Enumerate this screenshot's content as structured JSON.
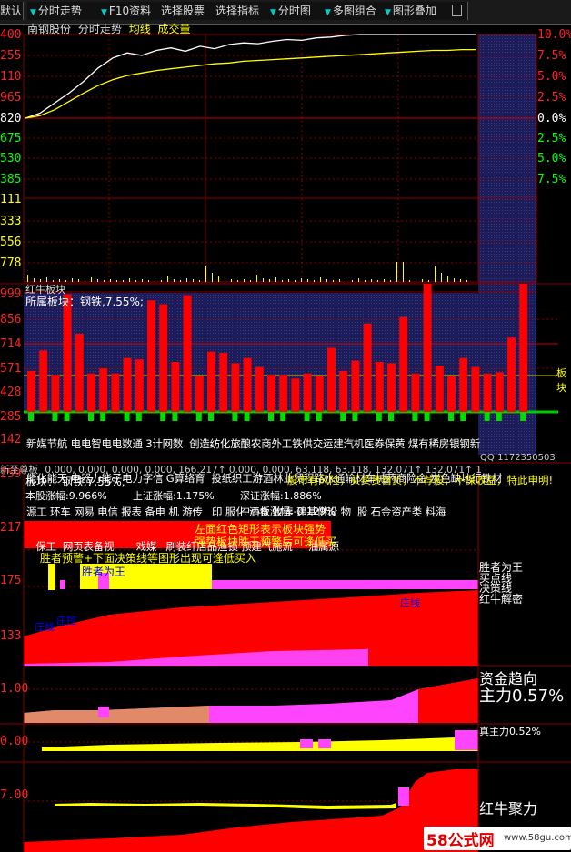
{
  "toolbar": {
    "items": [
      {
        "label": "默认",
        "arrow": true
      },
      {
        "label": "分时走势",
        "arrow": true
      },
      {
        "label": "F10资料",
        "arrow": false
      },
      {
        "label": "选择股票",
        "arrow": false
      },
      {
        "label": "选择指标",
        "arrow": false
      },
      {
        "label": "分时图",
        "arrow": true
      },
      {
        "label": "多图组合",
        "arrow": true
      },
      {
        "label": "图形叠加",
        "arrow": true
      }
    ]
  },
  "intraday": {
    "stock": "南钢股份",
    "view": "分时走势",
    "avg_label": "均线",
    "vol_label": "成交量",
    "left_ticks": [
      "400",
      "255",
      "110",
      "965",
      "820"
    ],
    "right_ticks": [
      "10.0%",
      "7.5%",
      "5.0%",
      "2.5%",
      "0.0%"
    ],
    "left_ticks_low": [
      "675",
      "530",
      "385"
    ],
    "right_ticks_low": [
      "2.5%",
      "5.0%",
      "7.5%"
    ],
    "vol_ticks": [
      "111",
      "333",
      "556",
      "778"
    ]
  },
  "chart_data": [
    {
      "type": "line",
      "title": "分时走势",
      "series": [
        {
          "name": "价格",
          "color": "#ffffff",
          "values": [
            0,
            0.6,
            1.8,
            3.0,
            4.4,
            6.0,
            7.2,
            7.8,
            7.5,
            8.1,
            8.4,
            8.0,
            8.6,
            8.3,
            8.8,
            9.0,
            8.9,
            9.2,
            9.4,
            9.3,
            9.6,
            9.7,
            9.9,
            10.0,
            10.0,
            10.0,
            10.0,
            10.0,
            10.0,
            10.0,
            10.0,
            10.0
          ]
        },
        {
          "name": "均线",
          "color": "#ffff00",
          "values": [
            0,
            0.3,
            1.0,
            2.0,
            3.0,
            3.9,
            4.6,
            5.1,
            5.4,
            5.7,
            5.9,
            6.1,
            6.3,
            6.5,
            6.6,
            6.8,
            6.9,
            7.0,
            7.1,
            7.2,
            7.3,
            7.4,
            7.5,
            7.6,
            7.7,
            7.8,
            7.9,
            8.0,
            8.1,
            8.1,
            8.2,
            8.2
          ]
        }
      ],
      "ylim": [
        0,
        10
      ]
    },
    {
      "type": "bar",
      "title": "红牛板块",
      "subtitle": "所属板块：钢铁,7.55%;",
      "y_ticks": [
        "999",
        "856",
        "714",
        "571",
        "428",
        "285",
        "142"
      ],
      "right_label": "板块",
      "categories": [
        "新媒体",
        "节能",
        "航天",
        "电器",
        "电信",
        "智能",
        "电子",
        "电力",
        "电商",
        "数字",
        "通信",
        "3计",
        "网络",
        "数据",
        "创造",
        "纺织",
        "化工",
        "旅游",
        "酿酒",
        "农业",
        "商贸",
        "外贸",
        "工程",
        "铁路",
        "供水",
        "交通",
        "运输",
        "建材",
        "汽车",
        "机械",
        "医药",
        "券商",
        "保险",
        "黄金",
        "煤炭",
        "有色",
        "稀土",
        "房地产",
        "银行",
        "钢铁",
        "新疆",
        "上海"
      ],
      "values": [
        320,
        480,
        290,
        920,
        610,
        300,
        340,
        300,
        420,
        410,
        870,
        840,
        390,
        910,
        280,
        470,
        460,
        380,
        420,
        350,
        290,
        290,
        260,
        300,
        280,
        500,
        320,
        400,
        690,
        390,
        380,
        740,
        300,
        1000,
        360,
        280,
        420,
        350,
        300,
        310,
        580,
        1000
      ]
    },
    {
      "type": "area",
      "title": "红牛决策",
      "y_ticks": [
        "259",
        "217",
        "175",
        "133",
        "1.00",
        "0.00",
        "7.00"
      ]
    }
  ],
  "sector": {
    "y_ticks": [
      "999",
      "856",
      "714",
      "571",
      "428",
      "285",
      "142"
    ],
    "right_label": "板块",
    "label_rows": [
      "新媒节航 电电智电电数通 3计网数  创造纺化旅酿农商外工铁供交运建汽机医券保黄 煤有稀房银钢新",
      "能化能天 电器力能子电力字信 G算络育  投纸织工游酒林业贸程路水通输材车械药商险金 炭色缺地行铁材",
      "源工 环车 网易 电信 报表 备电 机 游传   印 服化 酒食 牧连 建基供设 物  股 石金资产类 料海",
      "   保工  网页表备视       戏媒   刷装纤店品渔锁 预建气施流     油属源"
    ]
  },
  "info": {
    "row_values": "0.000,  0.000,  0.000,  0.000,  166.217↑  0.000,  0.000,  63.118,  63.118,  132.071↑  132.071↑  1",
    "row_new": "新至尊板",
    "sector_line": "板块：   钢铁,7.55%;",
    "disclaimer": "股市有风险，买卖责自负，不荐股，不保收益，特此申明!",
    "stock_change": "本股涨幅:9.966%",
    "sh_change": "上证涨幅:1.175%",
    "sz_change": "深证涨幅:1.886%",
    "smb_change": "中小板涨幅:-0.129%",
    "left_axis_top": "259",
    "left_axis_217": "217",
    "red_note_1": "左面红色矩形表示板块强势",
    "red_note_2": "强势板块胜王预警后可逢低买",
    "warn_text": "胜者预警+下面决策线等图形出现可逢低买入",
    "wang_label": "胜者为王",
    "left_axis_175": "175",
    "left_axis_133": "133",
    "legend_1": "胜者为王",
    "legend_2": "买点线",
    "legend_3": "决策线",
    "legend_4": "红牛解密",
    "zhuang_1": "庄线",
    "zhuang_2": "庄线",
    "zhuang_3": "庄控",
    "qq": "QQ:1172350503"
  },
  "fund": {
    "title1": "资金趋向",
    "title2": "主力0.57%",
    "tick": "1.00"
  },
  "true_main": {
    "label": "真主力0.52%",
    "tick": "0.00"
  },
  "gather": {
    "label": "红牛聚力",
    "tick": "7.00"
  },
  "watermark": {
    "logo": "58公式网",
    "url": "www.58gu.com"
  }
}
